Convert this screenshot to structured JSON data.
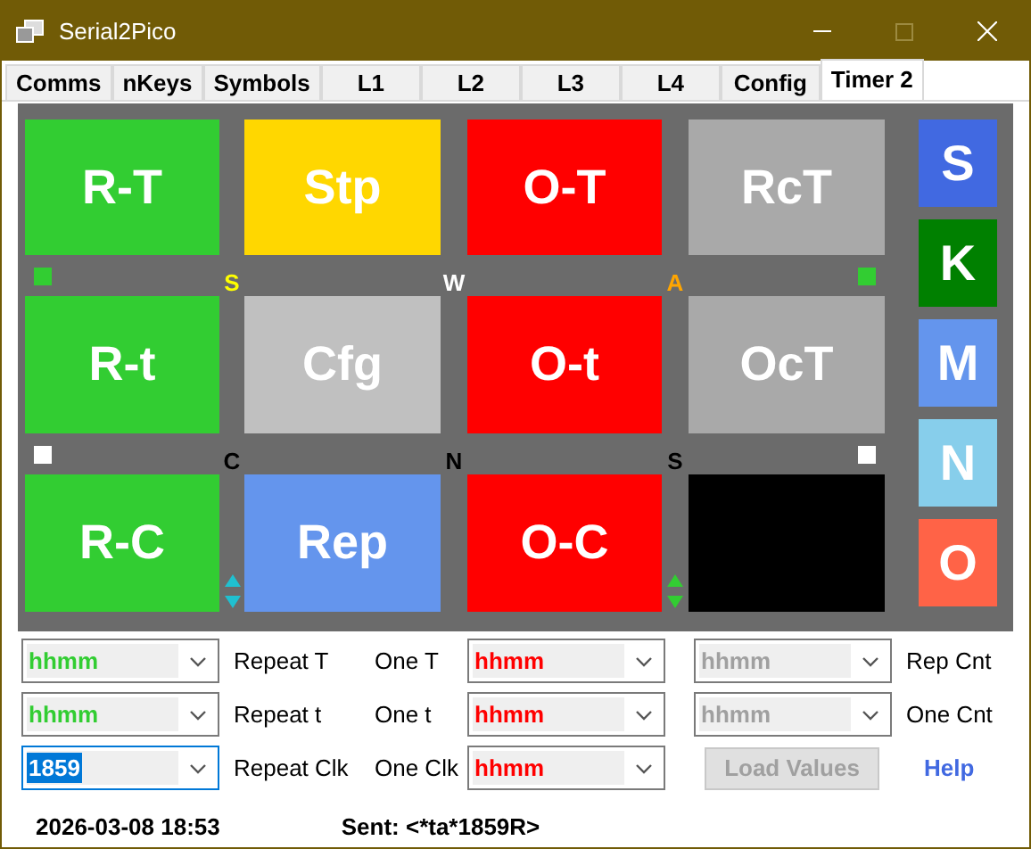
{
  "window": {
    "title": "Serial2Pico",
    "maximize_disabled": true
  },
  "tabs": [
    {
      "label": "Comms",
      "selected": false
    },
    {
      "label": "nKeys",
      "selected": false
    },
    {
      "label": "Symbols",
      "selected": false
    },
    {
      "label": "L1",
      "selected": false
    },
    {
      "label": "L2",
      "selected": false
    },
    {
      "label": "L3",
      "selected": false
    },
    {
      "label": "L4",
      "selected": false
    },
    {
      "label": "Config",
      "selected": false
    },
    {
      "label": "Timer 2",
      "selected": true
    }
  ],
  "tile_rows": [
    {
      "tiles": [
        {
          "label": "R-T",
          "color": "#32cd32"
        },
        {
          "label": "Stp",
          "color": "#ffd700"
        },
        {
          "label": "O-T",
          "color": "#ff0000"
        },
        {
          "label": "RcT",
          "color": "#a9a9a9"
        }
      ]
    },
    {
      "tiles": [
        {
          "label": "R-t",
          "color": "#32cd32"
        },
        {
          "label": "Cfg",
          "color": "#c0c0c0"
        },
        {
          "label": "O-t",
          "color": "#ff0000"
        },
        {
          "label": "OcT",
          "color": "#a9a9a9"
        }
      ]
    },
    {
      "tiles": [
        {
          "label": "R-C",
          "color": "#32cd32"
        },
        {
          "label": "Rep",
          "color": "#6495ed"
        },
        {
          "label": "O-C",
          "color": "#ff0000"
        },
        {
          "color": "#000000"
        }
      ]
    }
  ],
  "marker_rows": [
    {
      "left_square": {
        "color": "#32cd32"
      },
      "letters": [
        {
          "text": "S",
          "color": "#ffff00"
        },
        {
          "text": "W",
          "color": "#ffffff"
        },
        {
          "text": "A",
          "color": "#ffa500"
        }
      ],
      "right_square": {
        "color": "#32cd32"
      }
    },
    {
      "left_square": {
        "color": "#ffffff"
      },
      "letters": [
        {
          "text": "C",
          "color": "#000000"
        },
        {
          "text": "N",
          "color": "#000000"
        },
        {
          "text": "S",
          "color": "#000000"
        }
      ],
      "right_square": {
        "color": "#ffffff"
      }
    }
  ],
  "spinners": [
    {
      "color": "#20c0d0"
    },
    {
      "color": "#32cd32"
    }
  ],
  "side_buttons": [
    {
      "label": "S",
      "color": "#4169e1"
    },
    {
      "label": "K",
      "color": "#008000"
    },
    {
      "label": "M",
      "color": "#6495ed"
    },
    {
      "label": "N",
      "color": "#87ceeb"
    },
    {
      "label": "O",
      "color": "#ff6347"
    }
  ],
  "form_rows": [
    {
      "items": [
        {
          "kind": "combo",
          "value": "hhmm",
          "color": "#32cd32",
          "highlighted": false
        },
        {
          "kind": "label",
          "text": "Repeat T"
        },
        {
          "kind": "label",
          "text": "One T"
        },
        {
          "kind": "combo",
          "value": "hhmm",
          "color": "#ff0000",
          "highlighted": false
        },
        {
          "kind": "combo",
          "value": "hhmm",
          "color": "#a0a0a0",
          "highlighted": false
        },
        {
          "kind": "label",
          "text": "Rep Cnt"
        }
      ]
    },
    {
      "items": [
        {
          "kind": "combo",
          "value": "hhmm",
          "color": "#32cd32",
          "highlighted": false
        },
        {
          "kind": "label",
          "text": "Repeat t"
        },
        {
          "kind": "label",
          "text": "One t"
        },
        {
          "kind": "combo",
          "value": "hhmm",
          "color": "#ff0000",
          "highlighted": false
        },
        {
          "kind": "combo",
          "value": "hhmm",
          "color": "#a0a0a0",
          "highlighted": false
        },
        {
          "kind": "label",
          "text": "One Cnt"
        }
      ]
    },
    {
      "items": [
        {
          "kind": "combo",
          "value": "1859",
          "highlighted": true
        },
        {
          "kind": "label",
          "text": "Repeat Clk"
        },
        {
          "kind": "label",
          "text": "One Clk"
        },
        {
          "kind": "combo",
          "value": "hhmm",
          "color": "#ff0000",
          "highlighted": false
        },
        {
          "kind": "button",
          "text": "Load Values",
          "disabled": true
        },
        {
          "kind": "link",
          "text": "Help"
        }
      ]
    }
  ],
  "status": {
    "datetime": "2026-03-08 18:53",
    "sent": "Sent: <*ta*1859R>"
  }
}
